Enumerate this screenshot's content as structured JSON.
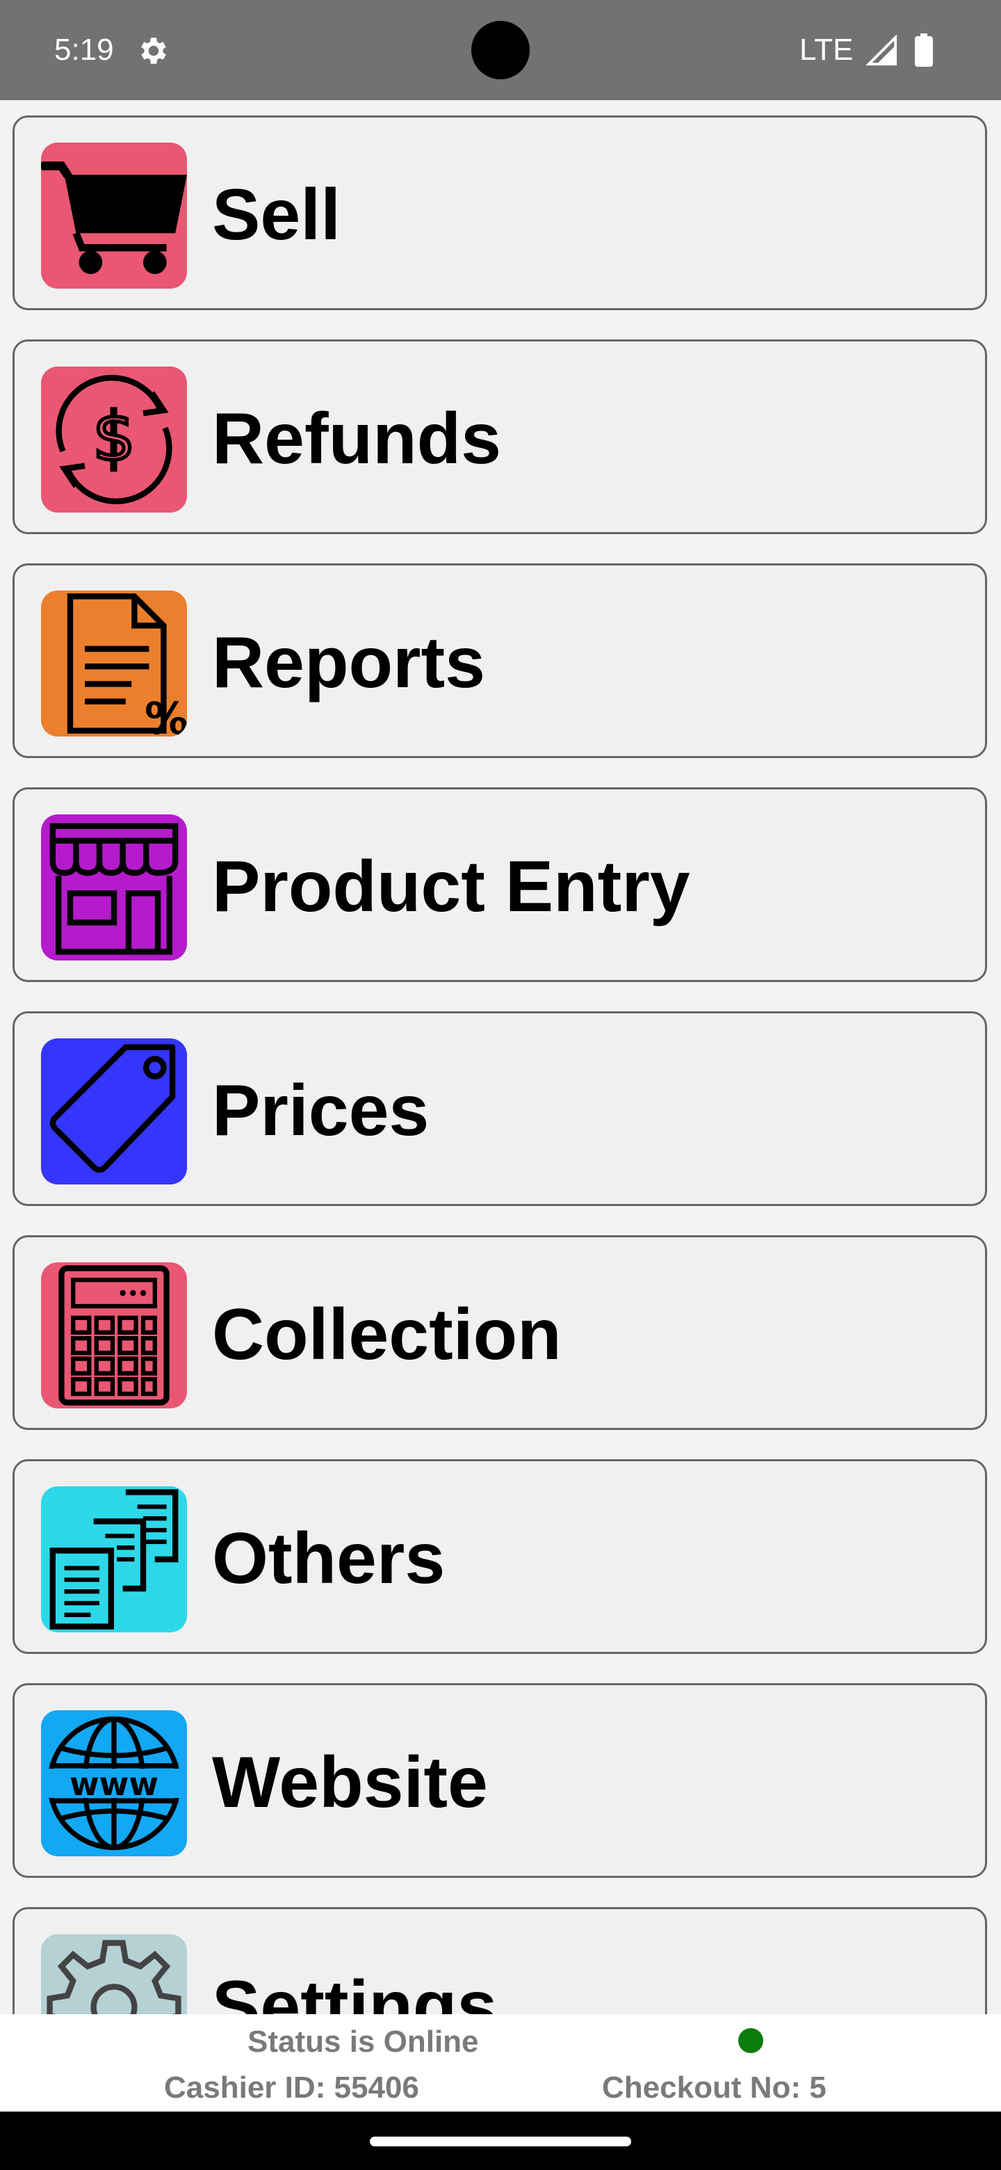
{
  "status_bar": {
    "time": "5:19",
    "network": "LTE",
    "icons": [
      "gear-icon",
      "signal-icon",
      "battery-icon"
    ],
    "background": "#727272"
  },
  "menu": {
    "items": [
      {
        "label": "Sell",
        "icon": "shopping-cart-icon",
        "color": "#ea5773"
      },
      {
        "label": "Refunds",
        "icon": "dollar-refresh-icon",
        "color": "#ea5773"
      },
      {
        "label": "Reports",
        "icon": "document-percent-icon",
        "color": "#ec7f2d"
      },
      {
        "label": "Product Entry",
        "icon": "storefront-icon",
        "color": "#b51bcc"
      },
      {
        "label": "Prices",
        "icon": "price-tag-icon",
        "color": "#3535fb"
      },
      {
        "label": "Collection",
        "icon": "calculator-icon",
        "color": "#ea5773"
      },
      {
        "label": "Others",
        "icon": "copy-documents-icon",
        "color": "#2cd8e8"
      },
      {
        "label": "Website",
        "icon": "globe-www-icon",
        "color": "#13a8f4"
      },
      {
        "label": "Settings",
        "icon": "settings-gear-icon",
        "color": "#b5d1d3"
      }
    ]
  },
  "footer": {
    "status": "Status is Online",
    "online_color": "#0a7d0a",
    "cashier": "Cashier ID: 55406",
    "checkout": "Checkout No: 5"
  }
}
